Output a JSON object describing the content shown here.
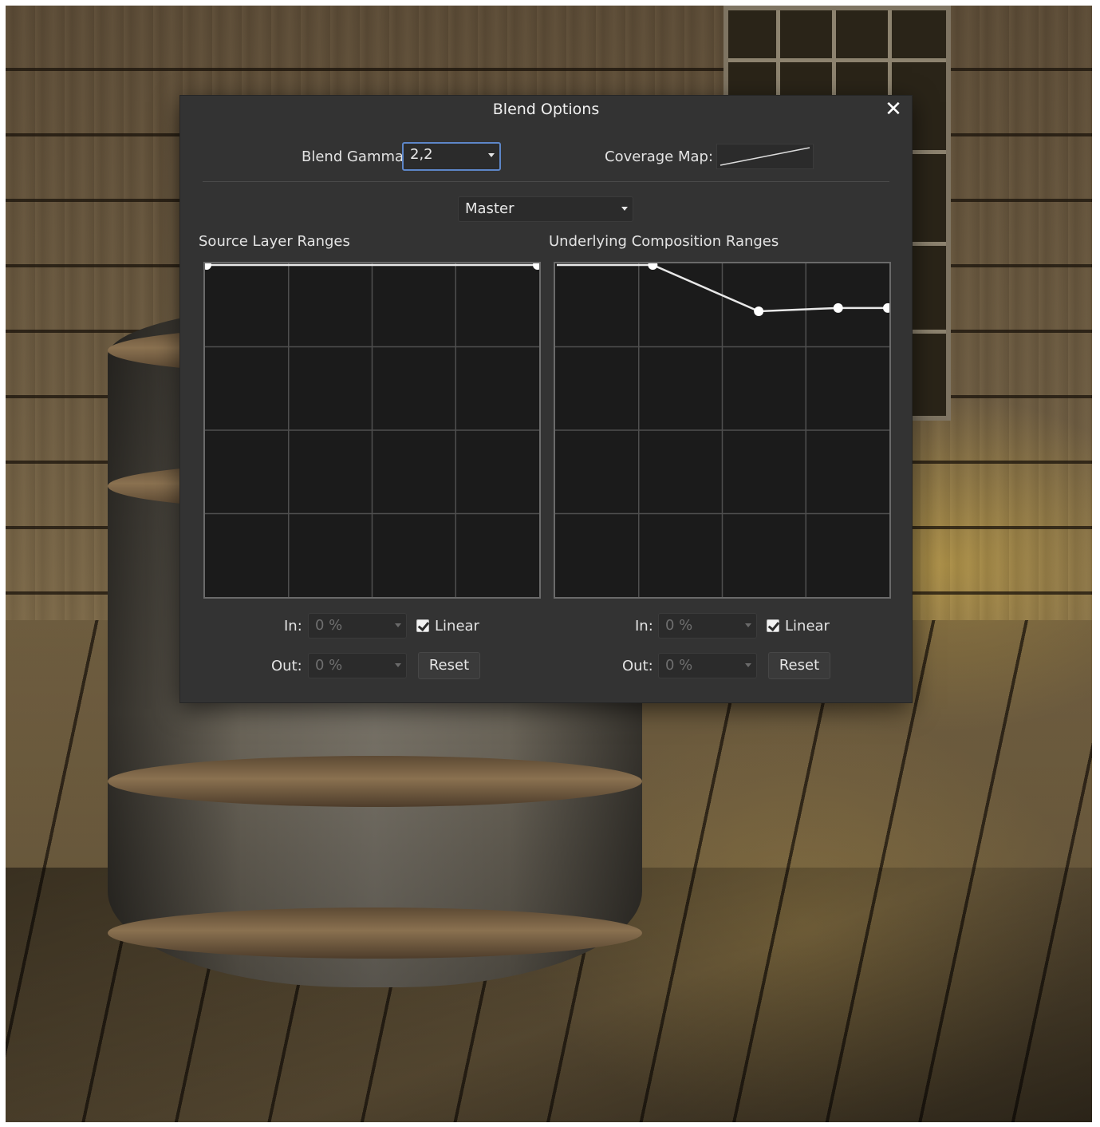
{
  "dialog": {
    "title": "Blend Options",
    "close_icon": "close-icon",
    "blend_gamma_label": "Blend Gamma:",
    "blend_gamma_value": "2,2",
    "coverage_map_label": "Coverage Map:",
    "channel_value": "Master",
    "source": {
      "title": "Source Layer Ranges",
      "in_label": "In:",
      "in_value": "0 %",
      "linear_label": "Linear",
      "linear_checked": true,
      "out_label": "Out:",
      "out_value": "0 %",
      "reset_label": "Reset",
      "curve_points": [
        [
          0,
          1.0
        ],
        [
          1.0,
          1.0
        ]
      ]
    },
    "underlying": {
      "title": "Underlying Composition Ranges",
      "in_label": "In:",
      "in_value": "0 %",
      "linear_label": "Linear",
      "linear_checked": true,
      "out_label": "Out:",
      "out_value": "0 %",
      "reset_label": "Reset",
      "curve_points": [
        [
          0,
          1.0
        ],
        [
          0.29,
          1.0
        ],
        [
          0.61,
          0.86
        ],
        [
          0.85,
          0.87
        ],
        [
          1.0,
          0.87
        ]
      ]
    }
  },
  "colors": {
    "dialog_bg": "#333333",
    "graph_bg": "#1b1b1b",
    "focus_border": "#5d86c8"
  }
}
